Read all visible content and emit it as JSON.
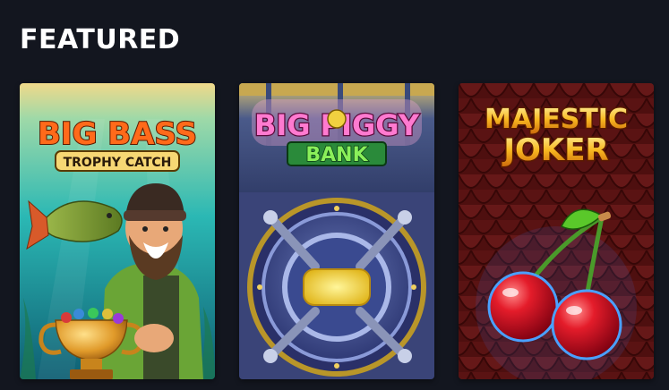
{
  "section": {
    "title": "FEATURED"
  },
  "games": [
    {
      "title": "Big Bass Trophy Catch",
      "logo_line1": "BIG BASS",
      "logo_line2": "TROPHY CATCH"
    },
    {
      "title": "Big Piggy Bank",
      "logo_line1": "BIG PIGGY",
      "logo_line2": "BANK"
    },
    {
      "title": "Majestic Joker",
      "logo_line1": "MAJESTIC",
      "logo_line2": "JOKER"
    }
  ],
  "colors": {
    "background": "#13161f",
    "title": "#ffffff"
  }
}
